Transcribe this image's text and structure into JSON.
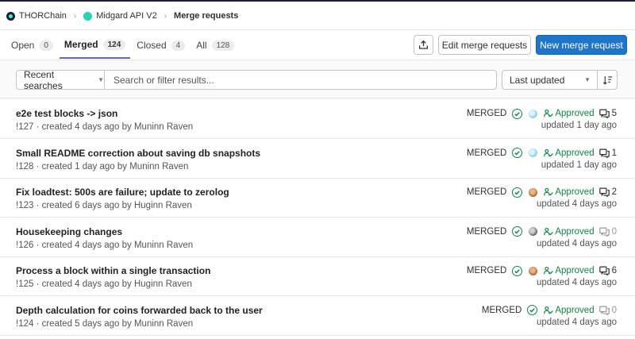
{
  "breadcrumb": [
    {
      "label": "THORChain"
    },
    {
      "label": "Midgard API V2"
    },
    {
      "label": "Merge requests"
    }
  ],
  "tabs": [
    {
      "label": "Open",
      "count": "0"
    },
    {
      "label": "Merged",
      "count": "124"
    },
    {
      "label": "Closed",
      "count": "4"
    },
    {
      "label": "All",
      "count": "128"
    }
  ],
  "actions": {
    "export_icon": "upload-icon",
    "edit_label": "Edit merge requests",
    "new_label": "New merge request"
  },
  "filter": {
    "recent_label": "Recent searches",
    "search_placeholder": "Search or filter results...",
    "sort_label": "Last updated",
    "sort_direction_icon": "sort-lowest-icon"
  },
  "colors": {
    "primary": "#1f75cb",
    "success": "#108548",
    "active_tab_underline": "#6666c4"
  },
  "merge_requests": [
    {
      "title": "e2e test blocks -> json",
      "meta": "!127 · created 4 days ago by ",
      "author": "Muninn Raven",
      "status": "MERGED",
      "approved": "Approved",
      "comments": "5",
      "updated": "updated 1 day ago",
      "avatar": "blue"
    },
    {
      "title": "Small README correction about saving db snapshots",
      "meta": "!128 · created 1 day ago by ",
      "author": "Muninn Raven",
      "status": "MERGED",
      "approved": "Approved",
      "comments": "1",
      "updated": "updated 1 day ago",
      "avatar": "blue"
    },
    {
      "title": "Fix loadtest: 500s are failure; update to zerolog",
      "meta": "!123 · created 6 days ago by ",
      "author": "Huginn Raven",
      "status": "MERGED",
      "approved": "Approved",
      "comments": "2",
      "updated": "updated 4 days ago",
      "avatar": "brown"
    },
    {
      "title": "Housekeeping changes",
      "meta": "!126 · created 4 days ago by ",
      "author": "Muninn Raven",
      "status": "MERGED",
      "approved": "Approved",
      "comments": "0",
      "updated": "updated 4 days ago",
      "avatar": "gray"
    },
    {
      "title": "Process a block within a single transaction",
      "meta": "!125 · created 4 days ago by ",
      "author": "Huginn Raven",
      "status": "MERGED",
      "approved": "Approved",
      "comments": "6",
      "updated": "updated 4 days ago",
      "avatar": "brown"
    },
    {
      "title": "Depth calculation for coins forwarded back to the user",
      "meta": "!124 · created 5 days ago by ",
      "author": "Muninn Raven",
      "status": "MERGED",
      "approved": "Approved",
      "comments": "0",
      "updated": "updated 4 days ago",
      "avatar": "none"
    }
  ]
}
